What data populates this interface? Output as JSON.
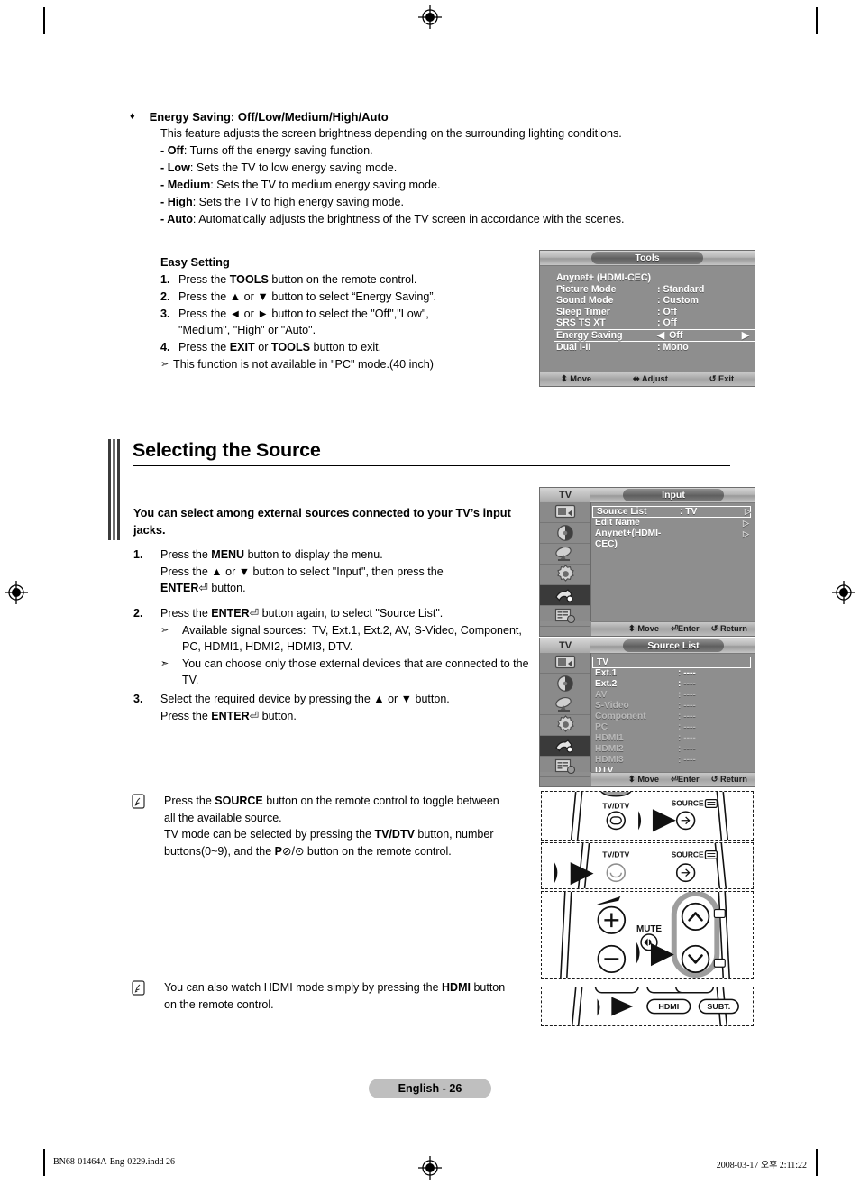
{
  "bullet": {
    "marker": "♦",
    "heading": "Energy Saving: Off/Low/Medium/High/Auto",
    "intro": "This feature adjusts the screen brightness depending on the surrounding lighting conditions.",
    "items": [
      {
        "term": "- Off",
        "desc": ": Turns off the energy saving function."
      },
      {
        "term": "- Low",
        "desc": ": Sets the TV to low energy saving mode."
      },
      {
        "term": "- Medium",
        "desc": ": Sets the TV to medium energy saving mode."
      },
      {
        "term": "- High",
        "desc": ": Sets the TV to high energy saving mode."
      },
      {
        "term": "- Auto",
        "desc": ": Automatically adjusts the brightness of the TV screen in accordance with the scenes."
      }
    ]
  },
  "easy_setting": {
    "title": "Easy Setting",
    "steps": [
      {
        "num": "1.",
        "text": "Press the TOOLS button on the remote control."
      },
      {
        "num": "2.",
        "text": "Press the ▲ or ▼ button to select “Energy Saving”."
      },
      {
        "num": "3.",
        "text": "Press the ◄ or ► button to select the \"Off\",\"Low\", \"Medium\", \"High\" or \"Auto\"."
      },
      {
        "num": "4.",
        "text": "Press the EXIT or TOOLS button to exit."
      }
    ],
    "note_marker": "➣",
    "note": "This function is not available in \"PC\" mode.(40 inch)"
  },
  "osd_tools": {
    "title": "Tools",
    "rows": [
      {
        "label": "Anynet+ (HDMI-CEC)",
        "value": "",
        "selected": false
      },
      {
        "label": "Picture Mode",
        "value": ": Standard",
        "selected": false
      },
      {
        "label": "Sound Mode",
        "value": ": Custom",
        "selected": false
      },
      {
        "label": "Sleep Timer",
        "value": ": Off",
        "selected": false
      },
      {
        "label": "SRS TS XT",
        "value": ": Off",
        "selected": false
      },
      {
        "label": "Energy Saving",
        "value": "Off",
        "selected": true
      },
      {
        "label": "Dual I-II",
        "value": ": Mono",
        "selected": false
      }
    ],
    "footer": [
      {
        "icon": "updown-arrow-icon",
        "glyph": "♦",
        "label": "Move"
      },
      {
        "icon": "leftright-arrow-icon",
        "glyph": "◀▶",
        "label": "Adjust"
      },
      {
        "icon": "return-icon",
        "glyph": "↰",
        "label": "Exit"
      }
    ]
  },
  "osd_input": {
    "tv_label": "TV",
    "title": "Input",
    "rows": [
      {
        "label": "Source List",
        "value": ": TV",
        "chevron": "▷",
        "selected": true,
        "dim": false
      },
      {
        "label": "Edit Name",
        "value": "",
        "chevron": "▷",
        "selected": false,
        "dim": false
      },
      {
        "label": "Anynet+(HDMI-CEC)",
        "value": "",
        "chevron": "▷",
        "selected": false,
        "dim": false
      }
    ],
    "footer": [
      {
        "icon": "updown-arrow-icon",
        "glyph": "♦",
        "label": "Move"
      },
      {
        "icon": "enter-icon",
        "glyph": "⏎",
        "label": "Enter"
      },
      {
        "icon": "return-icon",
        "glyph": "↰",
        "label": "Return"
      }
    ],
    "sidebar_icons": [
      "picture-icon",
      "sound-icon",
      "channel-icon",
      "setup-icon",
      "input-icon",
      "list-icon"
    ],
    "sidebar_active_index": 4
  },
  "osd_source": {
    "tv_label": "TV",
    "title": "Source List",
    "rows": [
      {
        "label": "TV",
        "value": "",
        "selected": true,
        "dim": false
      },
      {
        "label": "Ext.1",
        "value": ": ----",
        "selected": false,
        "dim": false
      },
      {
        "label": "Ext.2",
        "value": ": ----",
        "selected": false,
        "dim": false
      },
      {
        "label": "AV",
        "value": ": ----",
        "selected": false,
        "dim": true
      },
      {
        "label": "S-Video",
        "value": ": ----",
        "selected": false,
        "dim": true
      },
      {
        "label": "Component",
        "value": ": ----",
        "selected": false,
        "dim": true
      },
      {
        "label": "PC",
        "value": ": ----",
        "selected": false,
        "dim": true
      },
      {
        "label": "HDMI1",
        "value": ": ----",
        "selected": false,
        "dim": true
      },
      {
        "label": "HDMI2",
        "value": ": ----",
        "selected": false,
        "dim": true
      },
      {
        "label": "HDMI3",
        "value": ": ----",
        "selected": false,
        "dim": true
      },
      {
        "label": "DTV",
        "value": "",
        "selected": false,
        "dim": false
      }
    ],
    "footer": [
      {
        "icon": "updown-arrow-icon",
        "glyph": "♦",
        "label": "Move"
      },
      {
        "icon": "enter-icon",
        "glyph": "⏎",
        "label": "Enter"
      },
      {
        "icon": "return-icon",
        "glyph": "↰",
        "label": "Return"
      }
    ],
    "sidebar_icons": [
      "picture-icon",
      "sound-icon",
      "channel-icon",
      "setup-icon",
      "input-icon",
      "list-icon"
    ],
    "sidebar_active_index": 4
  },
  "section": {
    "heading": "Selecting the Source",
    "lead": "You can select among external sources connected to your TV’s input jacks.",
    "steps": [
      {
        "num": "1.",
        "lines": [
          "Press the MENU button to display the menu.",
          "Press the ▲ or ▼ button to select \"Input\", then press the ENTER⏎ button."
        ],
        "subs": []
      },
      {
        "num": "2.",
        "lines": [
          "Press the ENTER⏎ button again, to select \"Source List\"."
        ],
        "subs": [
          "Available signal sources:  TV, Ext.1, Ext.2, AV, S-Video, Component, PC, HDMI1, HDMI2, HDMI3, DTV.",
          "You can choose only those external devices that are connected to the TV."
        ]
      },
      {
        "num": "3.",
        "lines": [
          "Select the required device by pressing the ▲ or ▼ button.",
          "Press the ENTER⏎ button."
        ],
        "subs": []
      }
    ],
    "sub_marker": "➣"
  },
  "notes": [
    {
      "icon": "note-icon",
      "text": "Press the SOURCE button on the remote control to toggle between all the available source. TV mode can be selected by pressing the TV/DTV button, number buttons(0~9), and the P⌃/⌄ button on the remote control."
    },
    {
      "icon": "note-icon",
      "text": "You can also watch HDMI mode simply by pressing the HDMI button on the remote control."
    }
  ],
  "remote_panels": [
    {
      "name": "remote-panel-source",
      "labels": [
        "TV/DTV",
        "SOURCE"
      ]
    },
    {
      "name": "remote-panel-tvdtv",
      "labels": [
        "TV/DTV",
        "SOURCE"
      ]
    },
    {
      "name": "remote-panel-pchannel",
      "labels": [
        "MUTE",
        "+",
        "-"
      ]
    },
    {
      "name": "remote-panel-hdmi",
      "labels": [
        "HDMI",
        "SUBT."
      ]
    }
  ],
  "footer": {
    "page_badge": "English - 26",
    "file_name": "BN68-01464A-Eng-0229.indd   26",
    "timestamp": "2008-03-17   오후 2:11:22"
  },
  "colors": {
    "osd_bg": "#8e8e8e",
    "osd_highlight": "#ffffff",
    "badge_bg": "#bfbfbf",
    "rule": "#000000"
  }
}
